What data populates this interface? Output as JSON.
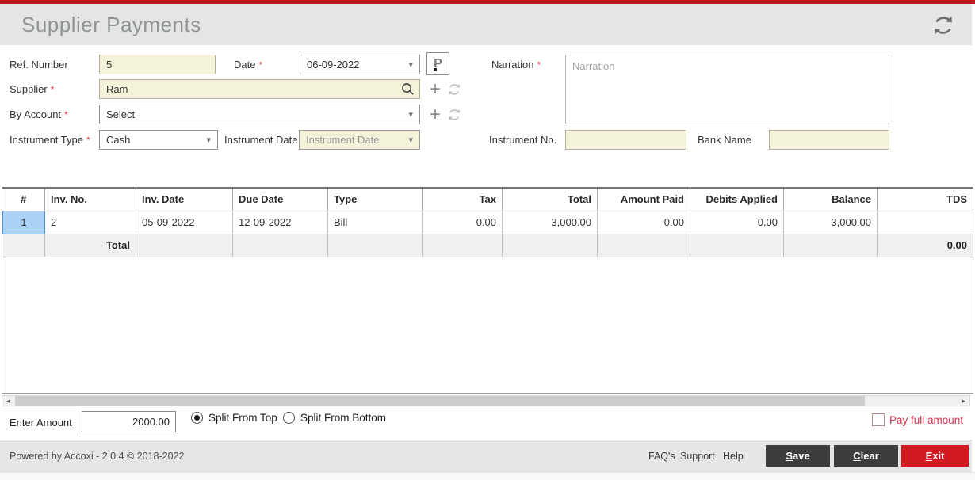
{
  "header": {
    "title": "Supplier Payments"
  },
  "required_marker": "*",
  "form": {
    "ref_number": {
      "label": "Ref. Number",
      "value": "5"
    },
    "date": {
      "label": "Date",
      "value": "06-09-2022"
    },
    "supplier": {
      "label": "Supplier",
      "value": "Ram"
    },
    "by_account": {
      "label": "By Account",
      "value": "Select"
    },
    "instrument_type": {
      "label": "Instrument Type",
      "value": "Cash"
    },
    "instrument_date": {
      "label": "Instrument Date",
      "value": "Instrument Date"
    },
    "narration": {
      "label": "Narration",
      "placeholder": "Narration"
    },
    "instrument_no": {
      "label": "Instrument No.",
      "value": ""
    },
    "bank_name": {
      "label": "Bank Name",
      "value": ""
    }
  },
  "table": {
    "columns": [
      "#",
      "Inv. No.",
      "Inv. Date",
      "Due Date",
      "Type",
      "Tax",
      "Total",
      "Amount Paid",
      "Debits Applied",
      "Balance",
      "TDS"
    ],
    "rows": [
      [
        "1",
        "2",
        "05-09-2022",
        "12-09-2022",
        "Bill",
        "0.00",
        "3,000.00",
        "0.00",
        "0.00",
        "3,000.00",
        ""
      ]
    ],
    "total_row": {
      "label": "Total",
      "tds_total": "0.00"
    }
  },
  "amount_bar": {
    "enter_amount_label": "Enter Amount",
    "enter_amount_value": "2000.00",
    "split_from_top_label": "Split From Top",
    "split_from_bottom_label": "Split From Bottom",
    "selected_split": "Split From Top",
    "pay_full_amount_label": "Pay full amount",
    "pay_full_amount_checked": false
  },
  "footer": {
    "powered_by": "Powered by Accoxi - 2.0.4 © 2018-2022",
    "links": [
      "FAQ's",
      "Support",
      "Help"
    ],
    "buttons": {
      "save": "Save",
      "clear": "Clear",
      "exit": "Exit"
    }
  },
  "icons": {
    "refresh": "refresh-arrows",
    "search": "magnifier",
    "add": "+",
    "caret": "▾",
    "scroll_left": "◂",
    "scroll_right": "▸",
    "payment": "P"
  },
  "colors": {
    "top_bar_red": "#c3161d",
    "exit_button_red": "#d51920",
    "input_beige": "#f5f2da",
    "selected_cell_blue": "#abd3f5",
    "pay_full_amount_red": "#d8304a",
    "header_gray": "#e5e5e5"
  }
}
